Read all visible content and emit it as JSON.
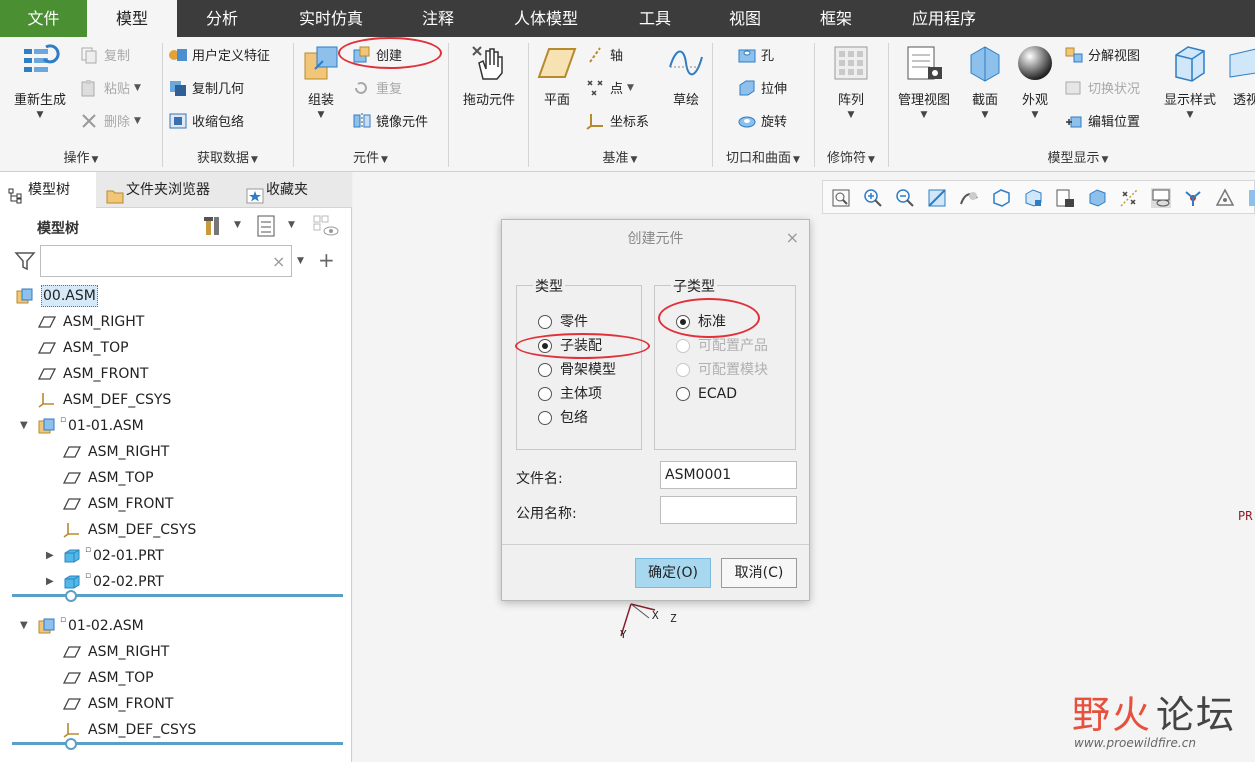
{
  "tabs": [
    "文件",
    "模型",
    "分析",
    "实时仿真",
    "注释",
    "人体模型",
    "工具",
    "视图",
    "框架",
    "应用程序"
  ],
  "ribbon": {
    "operations": {
      "regenerate": "重新生成",
      "copy": "复制",
      "paste": "粘贴",
      "delete": "删除",
      "group": "操作"
    },
    "get_data": {
      "udf": "用户定义特征",
      "copy_geom": "复制几何",
      "shrinkwrap": "收缩包络",
      "group": "获取数据"
    },
    "component": {
      "assemble": "组装",
      "create": "创建",
      "repeat": "重复",
      "mirror": "镜像元件",
      "group": "元件"
    },
    "drag": {
      "label": "拖动元件"
    },
    "datum": {
      "plane": "平面",
      "axis": "轴",
      "point": "点",
      "csys": "坐标系",
      "sketch": "草绘",
      "group": "基准"
    },
    "cut_surface": {
      "hole": "孔",
      "extrude": "拉伸",
      "revolve": "旋转",
      "group": "切口和曲面"
    },
    "modifiers": {
      "pattern": "阵列",
      "group": "修饰符"
    },
    "model_display": {
      "manage_views": "管理视图",
      "section": "截面",
      "appearance": "外观",
      "exploded_view": "分解视图",
      "toggle_status": "切换状况",
      "edit_position": "编辑位置",
      "display_style": "显示样式",
      "perspective": "透视",
      "group": "模型显示"
    }
  },
  "panel_tabs": [
    "模型树",
    "文件夹浏览器",
    "收藏夹"
  ],
  "tree_header": "模型树",
  "tree": [
    {
      "label": "00.ASM",
      "kind": "asm",
      "indent": 0,
      "selected": true
    },
    {
      "label": "ASM_RIGHT",
      "kind": "plane",
      "indent": 1
    },
    {
      "label": "ASM_TOP",
      "kind": "plane",
      "indent": 1
    },
    {
      "label": "ASM_FRONT",
      "kind": "plane",
      "indent": 1
    },
    {
      "label": "ASM_DEF_CSYS",
      "kind": "csys",
      "indent": 1
    },
    {
      "label": "01-01.ASM",
      "kind": "asm",
      "indent": 1,
      "expanded": true
    },
    {
      "label": "ASM_RIGHT",
      "kind": "plane",
      "indent": 2
    },
    {
      "label": "ASM_TOP",
      "kind": "plane",
      "indent": 2
    },
    {
      "label": "ASM_FRONT",
      "kind": "plane",
      "indent": 2
    },
    {
      "label": "ASM_DEF_CSYS",
      "kind": "csys",
      "indent": 2
    },
    {
      "label": "02-01.PRT",
      "kind": "prt",
      "indent": 2,
      "collapsed": true
    },
    {
      "label": "02-02.PRT",
      "kind": "prt",
      "indent": 2,
      "collapsed": true
    },
    {
      "label": "01-02.ASM",
      "kind": "asm",
      "indent": 1,
      "expanded": true
    },
    {
      "label": "ASM_RIGHT",
      "kind": "plane",
      "indent": 2
    },
    {
      "label": "ASM_TOP",
      "kind": "plane",
      "indent": 2
    },
    {
      "label": "ASM_FRONT",
      "kind": "plane",
      "indent": 2
    },
    {
      "label": "ASM_DEF_CSYS",
      "kind": "csys",
      "indent": 2
    }
  ],
  "filter": {
    "value": "",
    "placeholder": ""
  },
  "dialog": {
    "title": "创建元件",
    "close": "×",
    "type_legend": "类型",
    "subtype_legend": "子类型",
    "types": [
      {
        "label": "零件",
        "checked": false
      },
      {
        "label": "子装配",
        "checked": true
      },
      {
        "label": "骨架模型",
        "checked": false
      },
      {
        "label": "主体项",
        "checked": false
      },
      {
        "label": "包络",
        "checked": false
      }
    ],
    "subtypes": [
      {
        "label": "标准",
        "checked": true,
        "disabled": false
      },
      {
        "label": "可配置产品",
        "checked": false,
        "disabled": true
      },
      {
        "label": "可配置模块",
        "checked": false,
        "disabled": true
      },
      {
        "label": "ECAD",
        "checked": false,
        "disabled": false
      }
    ],
    "filename_label": "文件名:",
    "filename_value": "ASM0001",
    "common_name_label": "公用名称:",
    "common_name_value": "",
    "ok": "确定(O)",
    "cancel": "取消(C)"
  },
  "canvas": {
    "axis_x": "X",
    "axis_y": "Y",
    "axis_z": "Z",
    "edge_text": "PR"
  },
  "watermark": {
    "line1a": "野火",
    "line1b": "论坛",
    "url": "www.proewildfire.cn"
  },
  "colors": {
    "tabbar": "#3c3c3c",
    "file_tab": "#4a8f31",
    "annotation": "#e0303a",
    "primary_button": "#a8d8f0"
  }
}
